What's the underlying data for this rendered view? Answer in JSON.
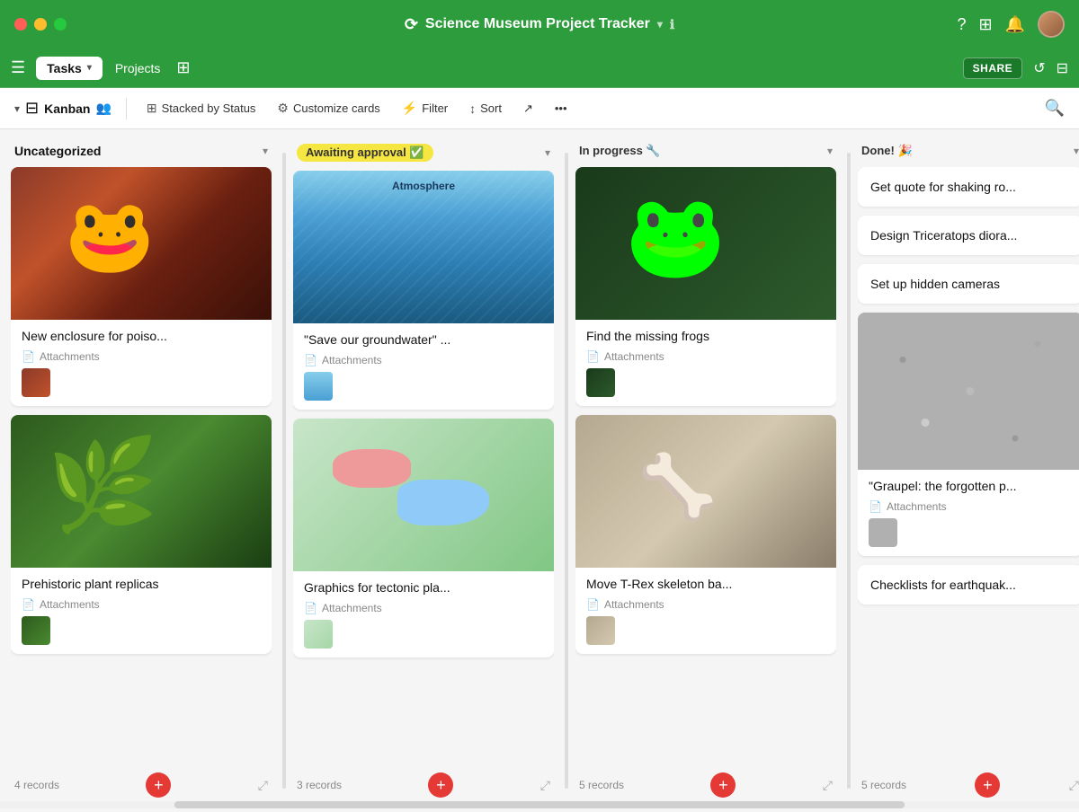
{
  "titleBar": {
    "title": "Science Museum Project Tracker",
    "icon": "⟳"
  },
  "toolbar1": {
    "tasks_label": "Tasks",
    "projects_label": "Projects",
    "share_label": "SHARE"
  },
  "toolbar2": {
    "kanban_label": "Kanban",
    "stacked_label": "Stacked by Status",
    "customize_label": "Customize cards",
    "filter_label": "Filter",
    "sort_label": "Sort"
  },
  "columns": [
    {
      "id": "uncategorized",
      "title": "Uncategorized",
      "records_count": "4 records",
      "cards": [
        {
          "id": "c1",
          "title": "New enclosure for poiso...",
          "has_image": true,
          "image_type": "frog",
          "thumb_type": "frog",
          "meta": "Attachments"
        },
        {
          "id": "c2",
          "title": "Prehistoric plant replicas",
          "has_image": true,
          "image_type": "plant",
          "thumb_type": "plant",
          "meta": "Attachments"
        }
      ]
    },
    {
      "id": "awaiting",
      "title": "Awaiting approval ✅",
      "title_raw": "Awaiting approval",
      "records_count": "3 records",
      "cards": [
        {
          "id": "c3",
          "title": "\"Save our groundwater\" ...",
          "has_image": true,
          "image_type": "water",
          "thumb_type": "water",
          "meta": "Attachments"
        },
        {
          "id": "c4",
          "title": "Graphics for tectonic pla...",
          "has_image": true,
          "image_type": "map",
          "thumb_type": "map",
          "meta": "Attachments"
        }
      ]
    },
    {
      "id": "inprogress",
      "title": "In progress 🔧",
      "title_raw": "In progress",
      "records_count": "5 records",
      "cards": [
        {
          "id": "c5",
          "title": "Find the missing frogs",
          "has_image": true,
          "image_type": "yellow-frog",
          "thumb_type": "frog2",
          "meta": "Attachments"
        },
        {
          "id": "c6",
          "title": "Move T-Rex skeleton ba...",
          "has_image": true,
          "image_type": "dinosaur",
          "thumb_type": "dino",
          "meta": "Attachments"
        }
      ]
    },
    {
      "id": "done",
      "title": "Done! 🎉",
      "title_raw": "Done!",
      "records_count": "5 records",
      "cards_simple": [
        {
          "id": "cs1",
          "title": "Get quote for shaking ro..."
        },
        {
          "id": "cs2",
          "title": "Design Triceratops diora..."
        },
        {
          "id": "cs3",
          "title": "Set up hidden cameras"
        }
      ],
      "card_with_image": {
        "id": "cs4",
        "title": "\"Graupel: the forgotten p...",
        "image_type": "coral",
        "thumb_type": "coral",
        "meta": "Attachments"
      },
      "card_last_simple": {
        "id": "cs5",
        "title": "Checklists for earthquak..."
      }
    }
  ]
}
